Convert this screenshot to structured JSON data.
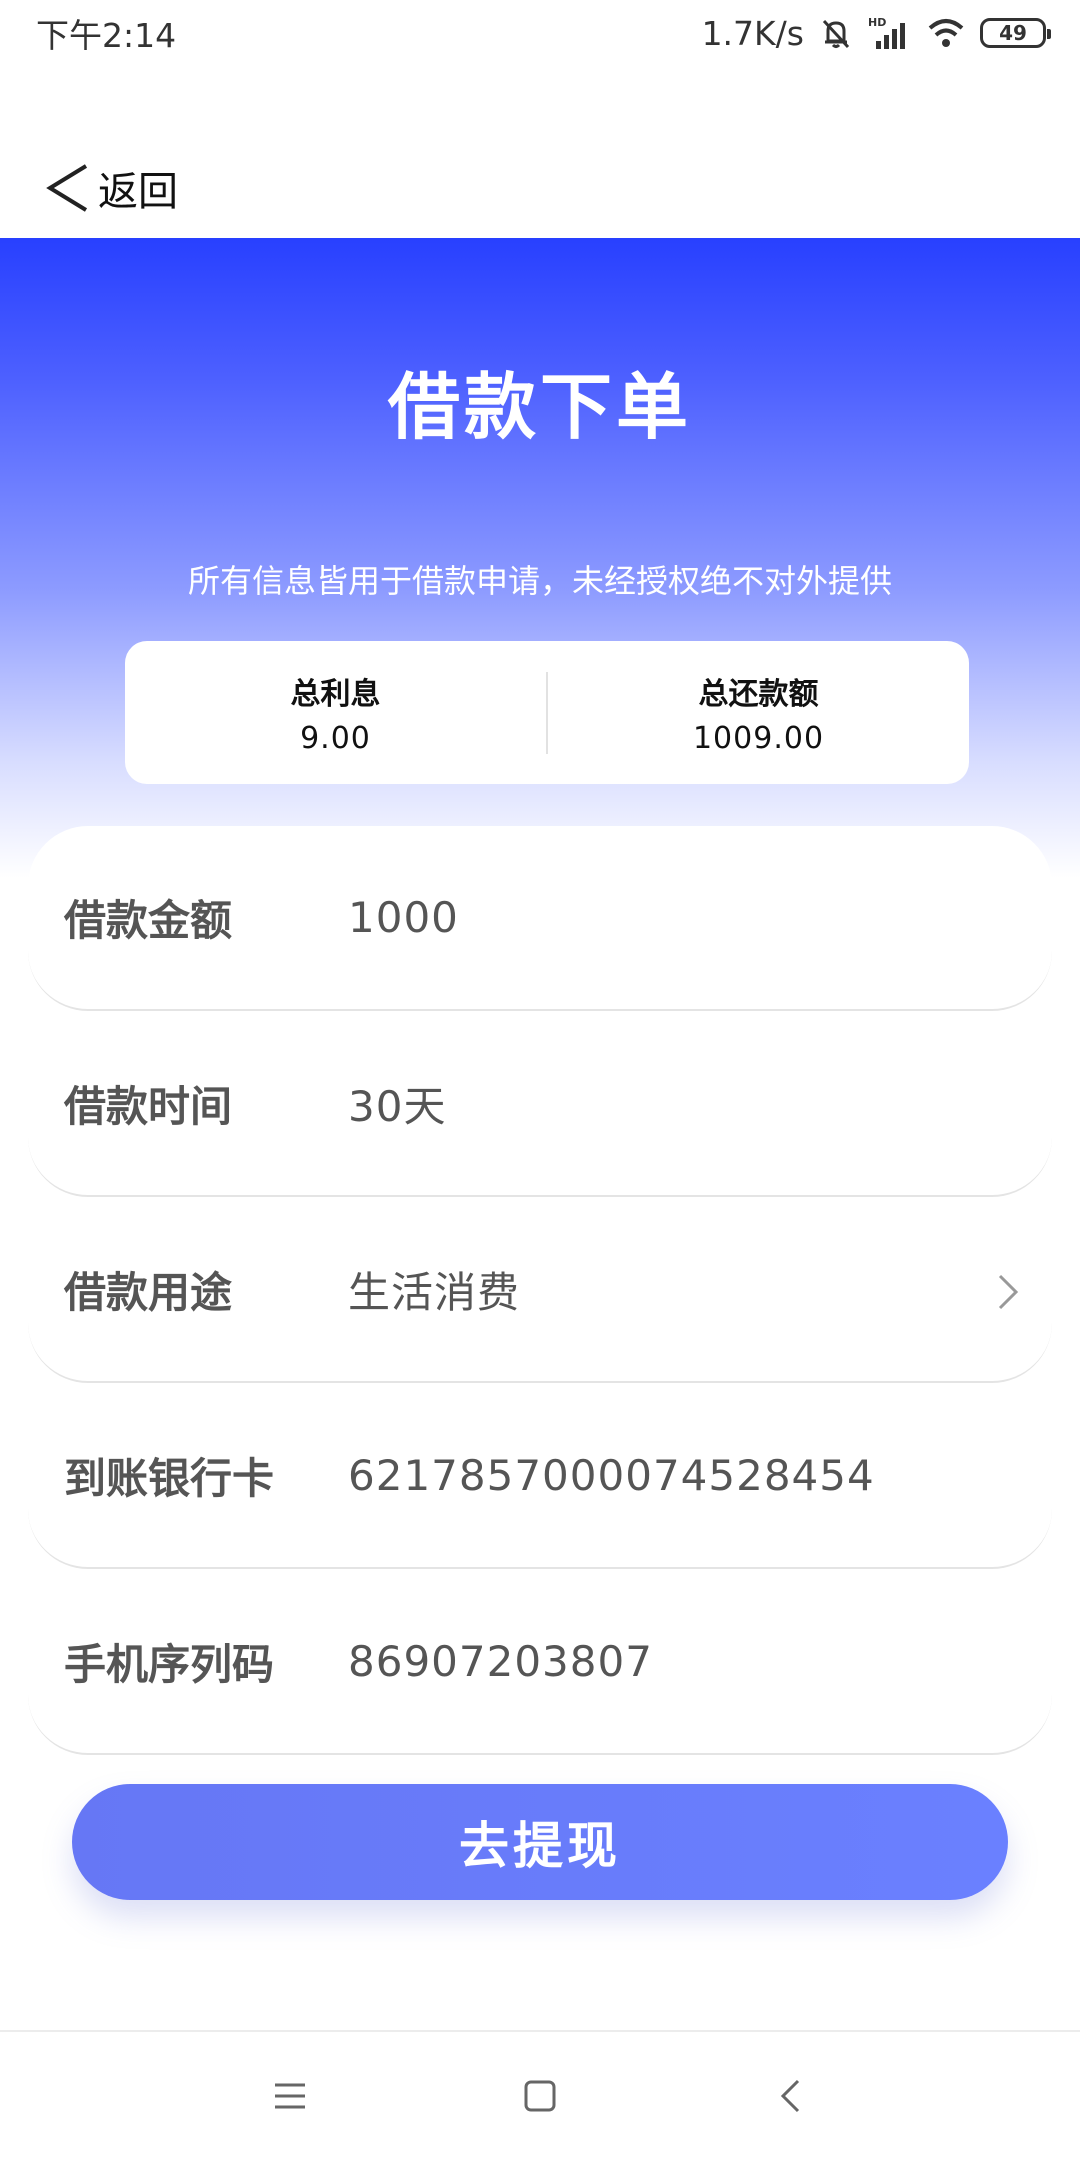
{
  "status_bar": {
    "time": "下午2:14",
    "network_speed": "1.7K/s",
    "battery": "49",
    "icons": [
      "mute-bell-icon",
      "hd-signal-icon",
      "wifi-icon",
      "battery-icon"
    ]
  },
  "nav": {
    "back_label": "返回",
    "icon": "chevron-left-icon"
  },
  "hero": {
    "title": "借款下单",
    "note": "所有信息皆用于借款申请，未经授权绝不对外提供"
  },
  "summary": {
    "interest_label": "总利息",
    "interest_value": "9.00",
    "total_label": "总还款额",
    "total_value": "1009.00"
  },
  "form": {
    "rows": [
      {
        "label": "借款金额",
        "value": "1000"
      },
      {
        "label": "借款时间",
        "value": "30天"
      },
      {
        "label": "借款用途",
        "value": "生活消费"
      },
      {
        "label": "到账银行卡",
        "value": "6217857000074528454"
      },
      {
        "label": "手机序列码",
        "value": "86907203807"
      }
    ]
  },
  "submit_label": "去提现",
  "colors": {
    "primary": "#2840ff",
    "button": "#6677f5"
  }
}
